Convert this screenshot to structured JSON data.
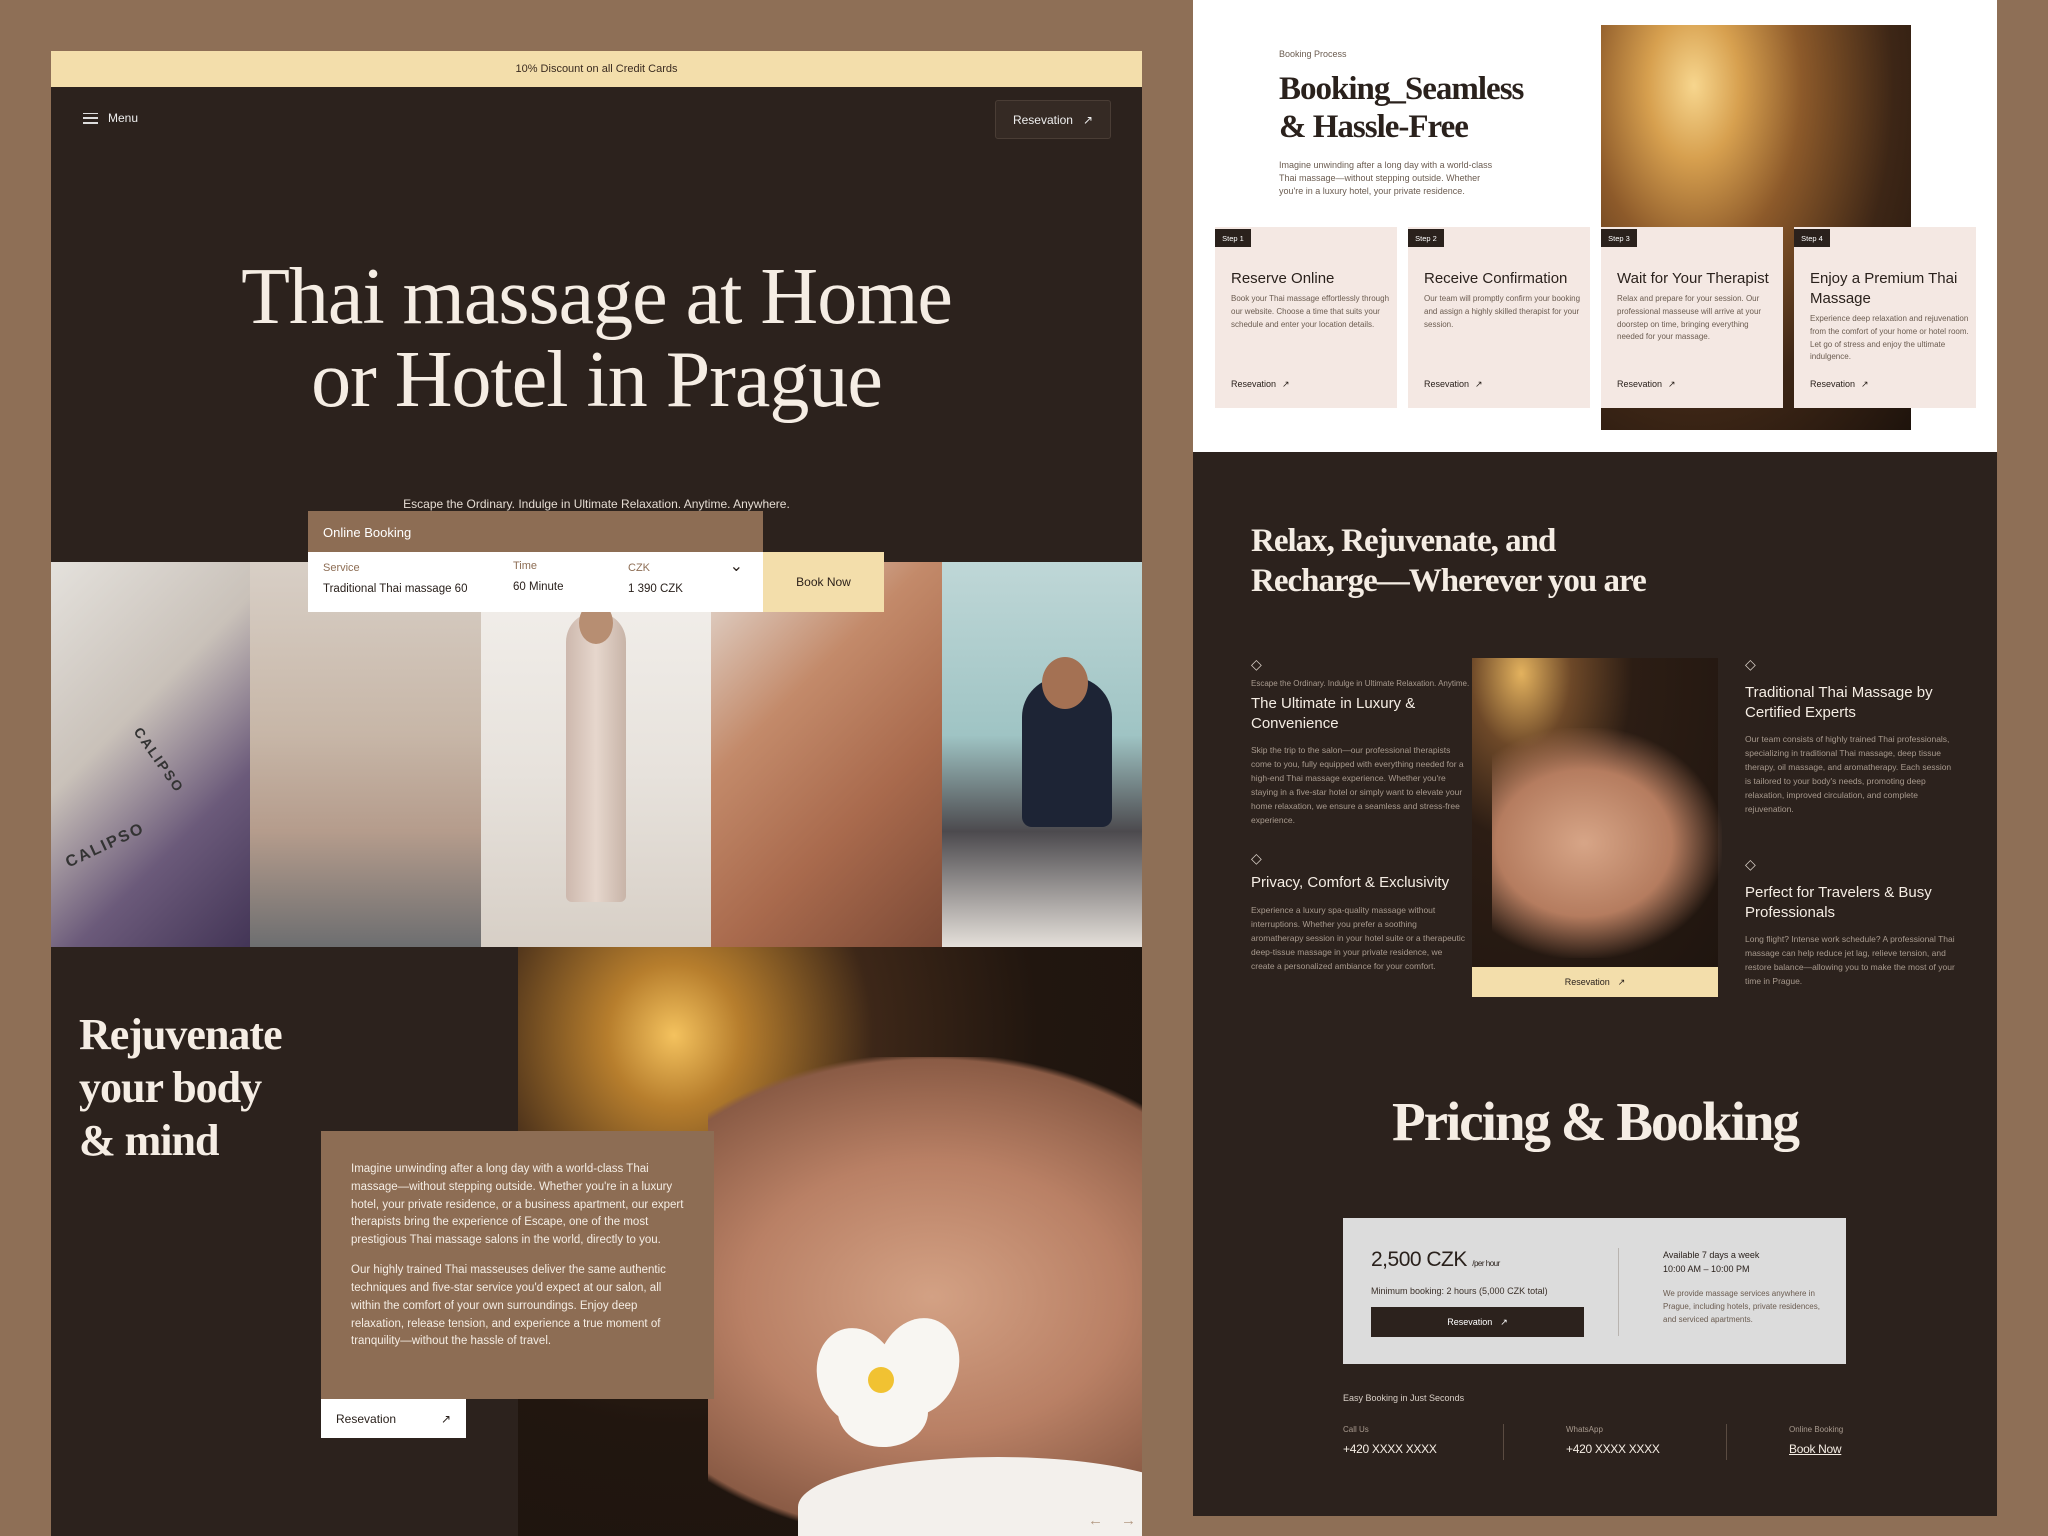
{
  "hero": {
    "promo": "10% Discount on all Credit Cards",
    "menu_label": "Menu",
    "reservation_label": "Resevation",
    "title_line1": "Thai massage at Home",
    "title_line2": "or Hotel in Prague",
    "subtitle": "Escape the Ordinary. Indulge in Ultimate Relaxation. Anytime. Anywhere.",
    "towel_brand": "CALIPSO"
  },
  "booking": {
    "tab_label": "Online Booking",
    "service_label": "Service",
    "service_value": "Traditional Thai massage 60",
    "time_label": "Time",
    "time_value": "60 Minute",
    "currency_label": "CZK",
    "price_value": "1 390 CZK",
    "book_now": "Book Now"
  },
  "rejuvenate": {
    "title_line1": "Rejuvenate",
    "title_line2": "your body",
    "title_line3": "& mind",
    "paragraph1": "Imagine unwinding after a long day with a world-class Thai massage—without stepping outside. Whether you're in a luxury hotel, your private residence, or a business apartment, our expert therapists bring the experience of Escape, one of the most prestigious Thai massage salons in the world, directly to you.",
    "paragraph2": "Our highly trained Thai masseuses deliver the same authentic techniques and five-star service you'd expect at our salon, all within the comfort of your own surroundings. Enjoy deep relaxation, release tension, and experience a true moment of tranquility—without the hassle of travel.",
    "reservation_label": "Resevation"
  },
  "process": {
    "label": "Booking Process",
    "title_line1": "Booking_Seamless",
    "title_line2": "& Hassle-Free",
    "description": "Imagine unwinding after a long day with a world-class Thai massage—without stepping outside. Whether you're in a luxury hotel, your private residence.",
    "steps": [
      {
        "tag": "Step 1",
        "title": "Reserve Online",
        "desc": "Book your Thai massage effortlessly through our website. Choose a time that suits your schedule and enter your location details.",
        "link": "Resevation"
      },
      {
        "tag": "Step 2",
        "title": "Receive Confirmation",
        "desc": "Our team will promptly confirm your booking and assign a highly skilled therapist for your session.",
        "link": "Resevation"
      },
      {
        "tag": "Step 3",
        "title": "Wait for Your Therapist",
        "desc": "Relax and prepare for your session. Our professional masseuse will arrive at your doorstep on time, bringing everything needed for your massage.",
        "link": "Resevation"
      },
      {
        "tag": "Step 4",
        "title": "Enjoy a Premium Thai Massage",
        "desc": "Experience deep relaxation and rejuvenation from the comfort of your home or hotel room. Let go of stress and enjoy the ultimate indulgence.",
        "link": "Resevation"
      }
    ]
  },
  "relax": {
    "title_line1": "Relax, Rejuvenate, and",
    "title_line2": "Recharge—Wherever you are",
    "kicker": "Escape the Ordinary. Indulge in Ultimate Relaxation. Anytime.",
    "features": [
      {
        "title": "The Ultimate in Luxury & Convenience",
        "desc": "Skip the trip to the salon—our professional therapists come to you, fully equipped with everything needed for a high-end Thai massage experience. Whether you're staying in a five-star hotel or simply want to elevate your home relaxation, we ensure a seamless and stress-free experience."
      },
      {
        "title": "Privacy, Comfort & Exclusivity",
        "desc": "Experience a luxury spa-quality massage without interruptions. Whether you prefer a soothing aromatherapy session in your hotel suite or a therapeutic deep-tissue massage in your private residence, we create a personalized ambiance for your comfort."
      },
      {
        "title": "Traditional Thai Massage by Certified Experts",
        "desc": "Our team consists of highly trained Thai professionals, specializing in traditional Thai massage, deep tissue therapy, oil massage, and aromatherapy. Each session is tailored to your body's needs, promoting deep relaxation, improved circulation, and complete rejuvenation."
      },
      {
        "title": "Perfect for Travelers & Busy Professionals",
        "desc": "Long flight? Intense work schedule? A professional Thai massage can help reduce jet lag, relieve tension, and restore balance—allowing you to make the most of your time in Prague."
      }
    ],
    "reservation_label": "Resevation"
  },
  "pricing": {
    "title": "Pricing & Booking",
    "price": "2,500 CZK",
    "unit": "/per hour",
    "minimum": "Minimum booking: 2 hours (5,000 CZK total)",
    "reservation_label": "Resevation",
    "availability_line1": "Available 7 days a week",
    "availability_line2": "10:00 AM – 10:00 PM",
    "availability_desc": "We provide massage services anywhere in Prague, including hotels, private residences, and serviced apartments.",
    "easy_booking": "Easy Booking in Just Seconds",
    "contacts": [
      {
        "label": "Call Us",
        "value": "+420 XXXX XXXX"
      },
      {
        "label": "WhatsApp",
        "value": "+420 XXXX XXXX"
      },
      {
        "label": "Online Booking",
        "value": "Book Now"
      }
    ]
  },
  "icons": {
    "arrow": "↗",
    "chevron": "⌄",
    "diamond": "◇",
    "prev": "←",
    "next": "→"
  },
  "colors": {
    "page_bg": "#8e6f56",
    "dark": "#2c221d",
    "accent_cream": "#f3deab",
    "accent_brown": "#8d6d54",
    "step_card": "#f4e8e3"
  }
}
